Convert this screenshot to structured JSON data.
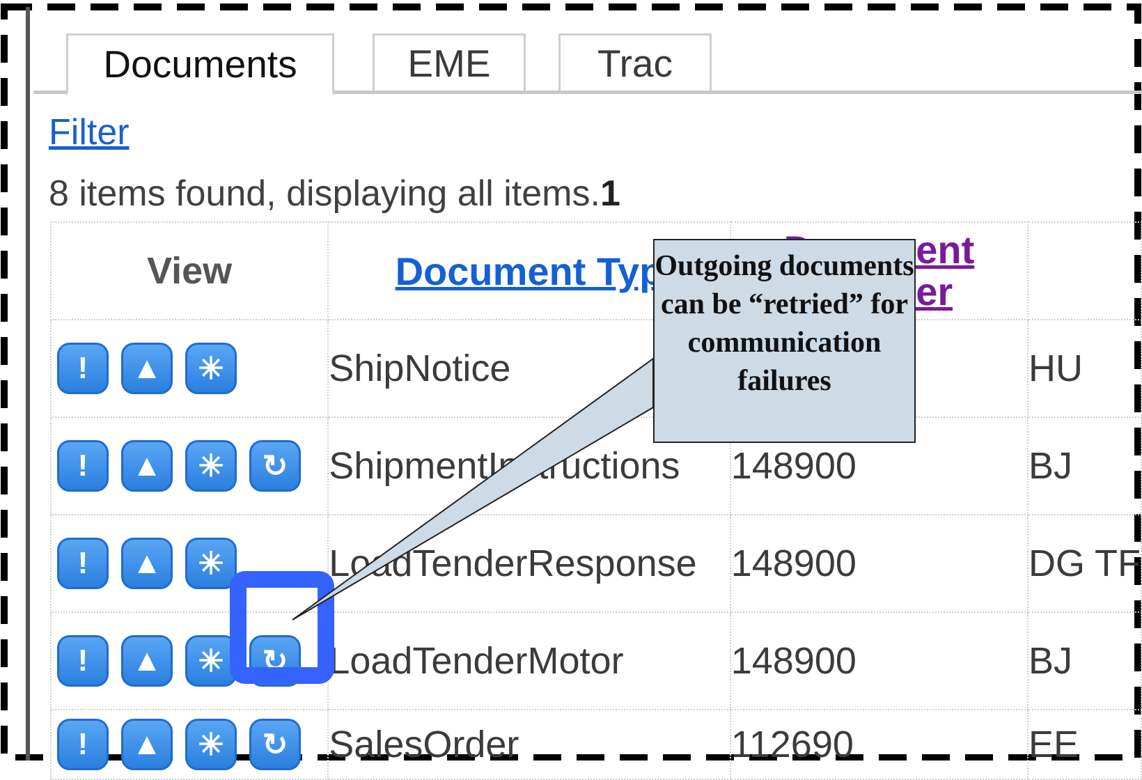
{
  "tabs": [
    {
      "label": "Documents",
      "active": true
    },
    {
      "label": "EME",
      "active": false
    },
    {
      "label": "Trac",
      "active": false
    }
  ],
  "filter_label": "Filter",
  "status": {
    "text": "8 items found, displaying all items.",
    "page": "1"
  },
  "table": {
    "headers": {
      "view": "View",
      "doc_type": "Document Typ",
      "doc_number": "Document\nNumber"
    },
    "rows": [
      {
        "type": "ShipNotice",
        "number": "",
        "extra": "HU",
        "retry": false
      },
      {
        "type": "ShipmentInstructions",
        "number": "148900",
        "extra": "BJ",
        "retry": true
      },
      {
        "type": "LoadTenderResponse",
        "number": "148900",
        "extra": "DG TF",
        "retry": false
      },
      {
        "type": "LoadTenderMotor",
        "number": "148900",
        "extra": "BJ",
        "retry": true
      },
      {
        "type": "SalesOrder",
        "number": "112690",
        "extra": "EE",
        "retry": true
      }
    ]
  },
  "callout": {
    "text": "Outgoing documents can be “retried” for communication failures"
  },
  "colors": {
    "accent": "#3563ff",
    "callout_bg": "#cddbe6",
    "link": "#1560d4",
    "visited": "#7a1a9a"
  }
}
